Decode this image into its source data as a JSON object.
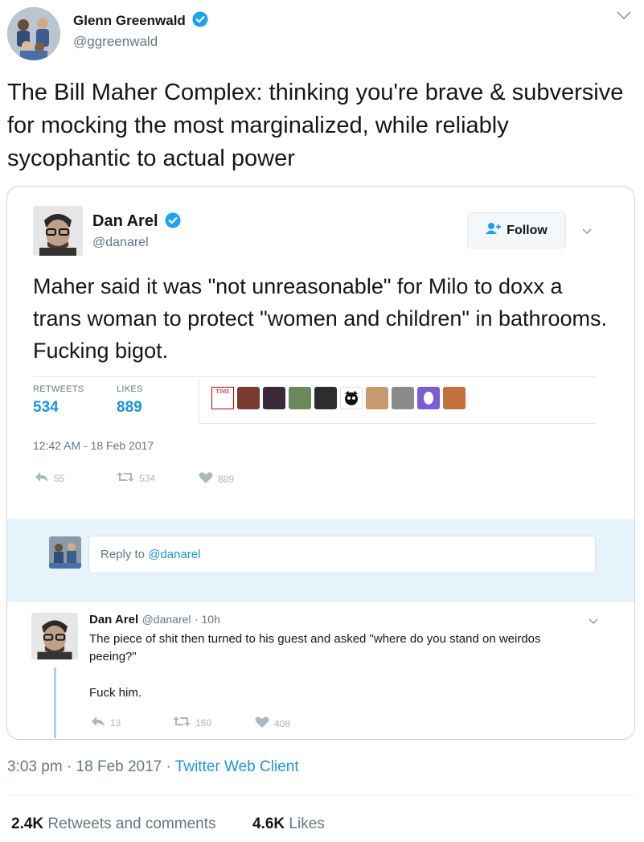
{
  "tweet": {
    "author_name": "Glenn Greenwald",
    "author_handle": "@ggreenwald",
    "text": "The Bill Maher Complex: thinking you're brave & subversive for mocking the most marginalized, while reliably sycophantic to actual power",
    "time": "3:03 pm",
    "date": "18 Feb 2017",
    "separator": "·",
    "client": "Twitter Web Client",
    "retweets_count": "2.4K",
    "retweets_label": "Retweets and comments",
    "likes_count": "4.6K",
    "likes_label": "Likes"
  },
  "quoted": {
    "author_name": "Dan Arel",
    "author_handle": "@danarel",
    "follow_label": "Follow",
    "text": "Maher said it was \"not unreasonable\" for Milo to doxx a trans woman to protect \"women and children\" in bathrooms. Fucking bigot.",
    "retweets_label": "RETWEETS",
    "retweets_value": "534",
    "likes_label": "LIKES",
    "likes_value": "889",
    "timestamp": "12:42 AM - 18 Feb 2017",
    "actions": {
      "reply": "55",
      "retweet": "534",
      "like": "889"
    },
    "liker_badge": "TIME",
    "reply_placeholder_prefix": "Reply to ",
    "reply_placeholder_mention": "@danarel",
    "reply": {
      "author_name": "Dan Arel",
      "author_handle": "@danarel",
      "time": "· 10h",
      "text1": "The piece of shit then turned to his guest and asked \"where do you stand on weirdos peeing?\"",
      "text2": "Fuck him.",
      "actions": {
        "reply": "13",
        "retweet": "160",
        "like": "408"
      }
    }
  },
  "colors": {
    "accent": "#1b95e0",
    "verified": "#1da1f2",
    "muted": "#657786"
  }
}
